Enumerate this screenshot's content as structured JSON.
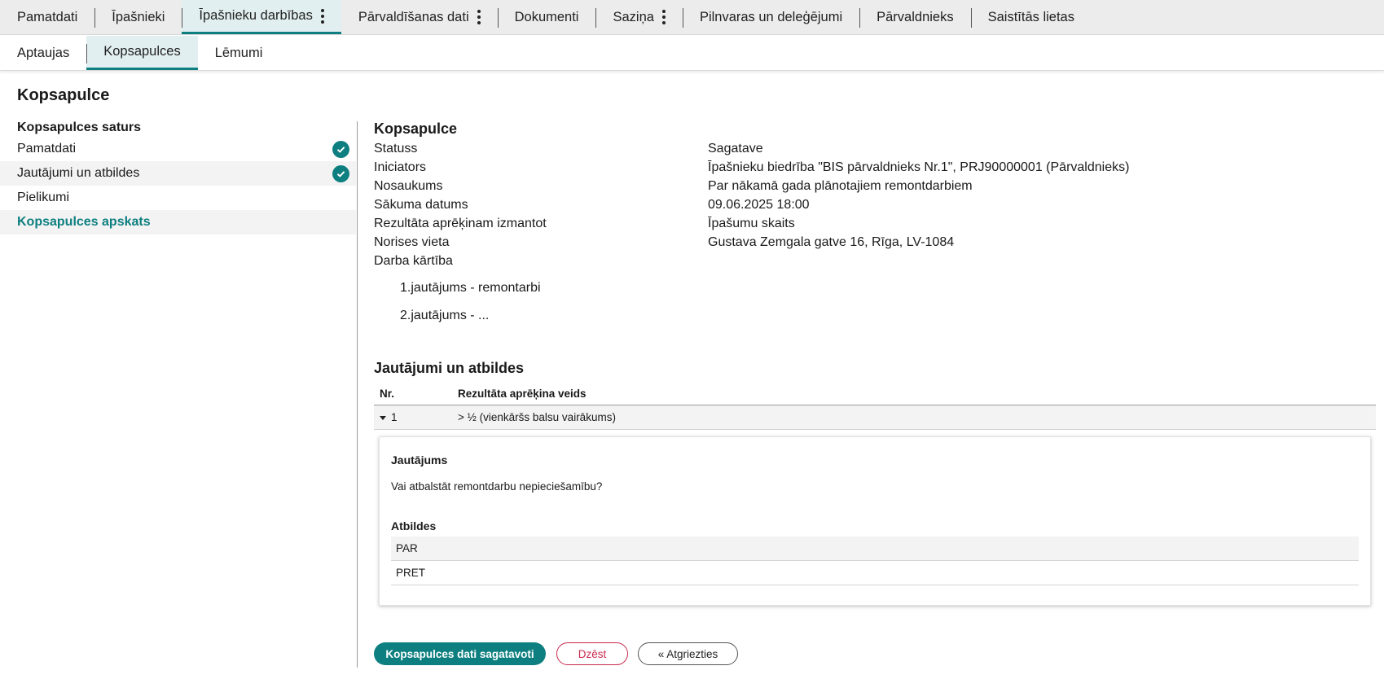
{
  "top_tabs": [
    {
      "label": "Pamatdati",
      "active": false,
      "menu": false
    },
    {
      "label": "Īpašnieki",
      "active": false,
      "menu": false
    },
    {
      "label": "Īpašnieku darbības",
      "active": true,
      "menu": true
    },
    {
      "label": "Pārvaldīšanas dati",
      "active": false,
      "menu": true
    },
    {
      "label": "Dokumenti",
      "active": false,
      "menu": false
    },
    {
      "label": "Saziņa",
      "active": false,
      "menu": true
    },
    {
      "label": "Pilnvaras un deleģējumi",
      "active": false,
      "menu": false
    },
    {
      "label": "Pārvaldnieks",
      "active": false,
      "menu": false
    },
    {
      "label": "Saistītās lietas",
      "active": false,
      "menu": false
    }
  ],
  "sub_tabs": [
    {
      "label": "Aptaujas",
      "active": false
    },
    {
      "label": "Kopsapulces",
      "active": true
    },
    {
      "label": "Lēmumi",
      "active": false
    }
  ],
  "page_title": "Kopsapulce",
  "sidebar": {
    "heading": "Kopsapulces saturs",
    "items": [
      {
        "label": "Pamatdati",
        "done": true
      },
      {
        "label": "Jautājumi un atbildes",
        "done": true
      },
      {
        "label": "Pielikumi",
        "done": false
      },
      {
        "label": "Kopsapulces apskats",
        "done": false,
        "current": true
      }
    ]
  },
  "meeting": {
    "title": "Kopsapulce",
    "fields": [
      {
        "label": "Statuss",
        "value": "Sagatave"
      },
      {
        "label": "Iniciators",
        "value": "Īpašnieku biedrība \"BIS pārvaldnieks Nr.1\", PRJ90000001 (Pārvaldnieks)"
      },
      {
        "label": "Nosaukums",
        "value": "Par nākamā gada plānotajiem remontdarbiem"
      },
      {
        "label": "Sākuma datums",
        "value": "09.06.2025 18:00"
      },
      {
        "label": "Rezultāta aprēķinam izmantot",
        "value": "Īpašumu skaits"
      },
      {
        "label": "Norises vieta",
        "value": "Gustava Zemgala gatve 16, Rīga, LV-1084"
      }
    ],
    "agenda_label": "Darba kārtība",
    "agenda": [
      "1.jautājums - remontarbi",
      "2.jautājums - ..."
    ]
  },
  "questions": {
    "title": "Jautājumi un atbildes",
    "headers": {
      "nr": "Nr.",
      "calc": "Rezultāta aprēķina veids"
    },
    "rows": [
      {
        "nr": "1",
        "calc": "> ½ (vienkāršs balsu vairākums)",
        "question_label": "Jautājums",
        "question": "Vai atbalstāt remontdarbu nepieciešamību?",
        "answers_label": "Atbildes",
        "answers": [
          "PAR",
          "PRET"
        ]
      }
    ]
  },
  "buttons": {
    "ready": "Kopsapulces dati sagatavoti",
    "delete": "Dzēst",
    "back": "« Atgriezties"
  },
  "colors": {
    "accent": "#0e7f80",
    "danger": "#c8294d"
  }
}
